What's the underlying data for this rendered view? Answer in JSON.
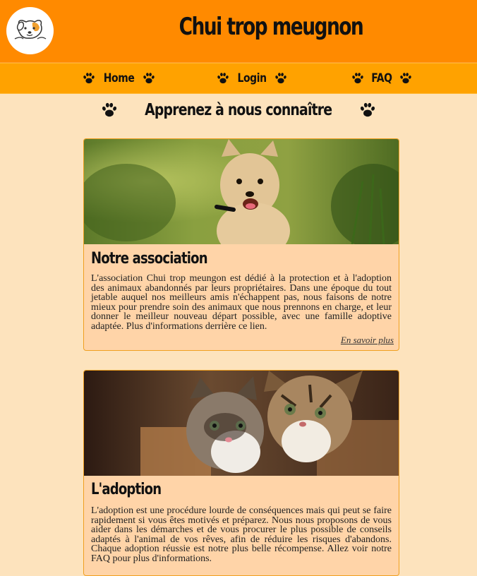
{
  "header": {
    "logo_icon": "dog-cat-logo-icon",
    "title": "Chui trop meugnon"
  },
  "nav": {
    "items": [
      {
        "label": "Home",
        "icon": "paw-icon"
      },
      {
        "label": "Login",
        "icon": "paw-icon"
      },
      {
        "label": "FAQ",
        "icon": "paw-icon"
      }
    ]
  },
  "section": {
    "title": "Apprenez à nous connaître"
  },
  "cards": [
    {
      "title": "Notre association",
      "text": "L'association Chui trop meungon est dédié à la protection et à l'adoption des animaux abandonnés par leurs propriétaires. Dans une époque du tout jetable auquel nos meilleurs amis n'échappent pas, nous faisons de notre mieux pour prendre soin des animaux que nous prennons en charge, et leur donner le meilleur nouveau départ possible, avec une famille adoptive adaptée. Plus d'informations derrière ce lien.",
      "link": "En savoir plus",
      "image": "puppy-photo"
    },
    {
      "title": "L'adoption",
      "text": "L'adoption est une procédure lourde de conséquences mais qui peut se faire rapidement si vous êtes motivés et préparez. Nous nous proposons de vous aider dans les démarches et de vous procurer le plus possible de conseils adaptés à l'animal de vos rêves, afin de réduire les risques d'abandons. Chaque adoption réussie est notre plus belle récompense. Allez voir notre FAQ pour plus d'informations.",
      "image": "kittens-photo"
    }
  ],
  "colors": {
    "header_bg": "#ff8a00",
    "nav_bg": "#ffa200",
    "page_bg": "#fde3bd",
    "card_bg": "#ffd4a8"
  }
}
